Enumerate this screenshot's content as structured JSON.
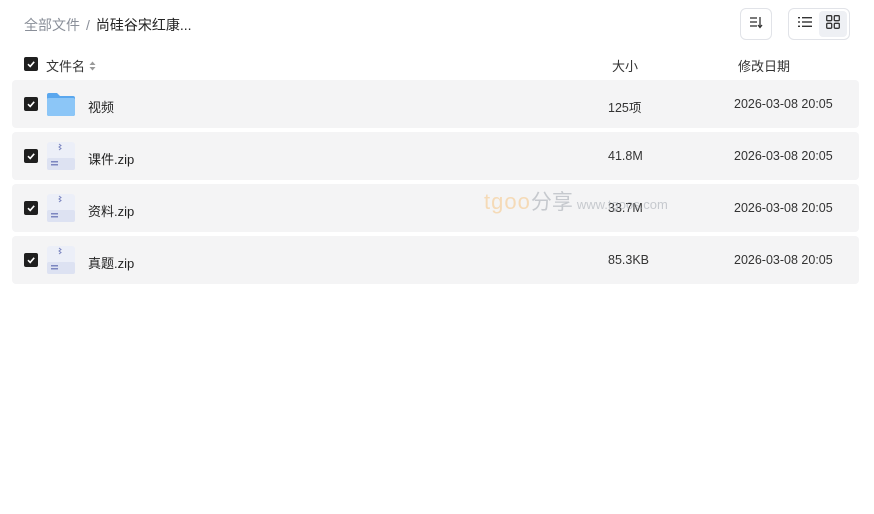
{
  "breadcrumb": {
    "root": "全部文件",
    "separator": "/",
    "current": "尚硅谷宋红康..."
  },
  "toolbar": {
    "sort_icon": "sort-icon",
    "list_view_icon": "list-view-icon",
    "grid_view_icon": "grid-view-icon",
    "active_view": "list"
  },
  "table": {
    "headers": {
      "name": "文件名",
      "size": "大小",
      "date": "修改日期"
    },
    "all_selected": true,
    "rows": [
      {
        "name": "视频",
        "size": "125项",
        "date": "2026-03-08 20:05",
        "type": "folder",
        "selected": true
      },
      {
        "name": "课件.zip",
        "size": "41.8M",
        "date": "2026-03-08 20:05",
        "type": "zip",
        "selected": true
      },
      {
        "name": "资料.zip",
        "size": "33.7M",
        "date": "2026-03-08 20:05",
        "type": "zip",
        "selected": true
      },
      {
        "name": "真题.zip",
        "size": "85.3KB",
        "date": "2026-03-08 20:05",
        "type": "zip",
        "selected": true
      }
    ]
  },
  "watermark": {
    "brand": "tgoo",
    "cn": "分享",
    "url": "www.tgoos.com"
  },
  "colors": {
    "row_bg": "#f4f4f5",
    "checkbox": "#1f1f1f",
    "folder": "#6fb3f2",
    "zip_icon": "#d9deef"
  }
}
